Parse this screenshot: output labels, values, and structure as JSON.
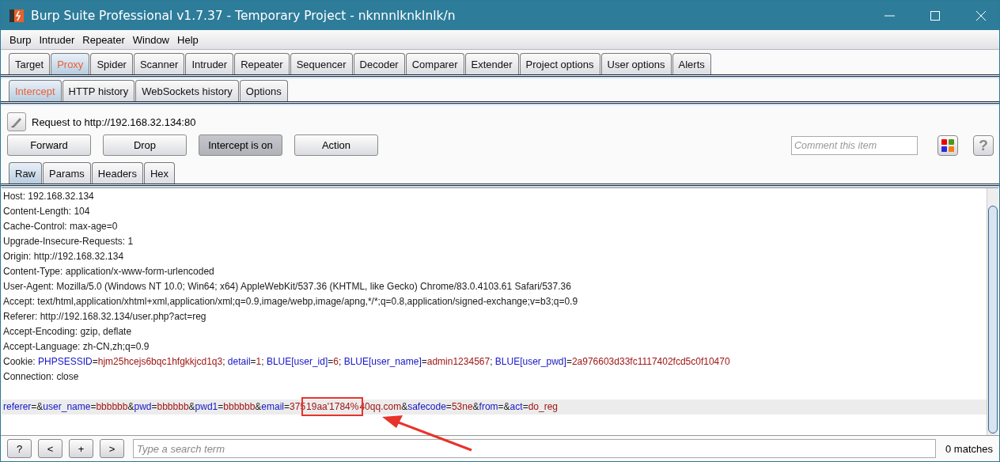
{
  "window": {
    "title": "Burp Suite Professional v1.7.37 - Temporary Project - nknnnlknklnlk/n"
  },
  "menu": [
    "Burp",
    "Intruder",
    "Repeater",
    "Window",
    "Help"
  ],
  "tabs": [
    {
      "label": "Target",
      "selected": false
    },
    {
      "label": "Proxy",
      "selected": true
    },
    {
      "label": "Spider",
      "selected": false
    },
    {
      "label": "Scanner",
      "selected": false
    },
    {
      "label": "Intruder",
      "selected": false
    },
    {
      "label": "Repeater",
      "selected": false
    },
    {
      "label": "Sequencer",
      "selected": false
    },
    {
      "label": "Decoder",
      "selected": false
    },
    {
      "label": "Comparer",
      "selected": false
    },
    {
      "label": "Extender",
      "selected": false
    },
    {
      "label": "Project options",
      "selected": false
    },
    {
      "label": "User options",
      "selected": false
    },
    {
      "label": "Alerts",
      "selected": false
    }
  ],
  "subtabs": [
    {
      "label": "Intercept",
      "selected": true
    },
    {
      "label": "HTTP history",
      "selected": false
    },
    {
      "label": "WebSockets history",
      "selected": false
    },
    {
      "label": "Options",
      "selected": false
    }
  ],
  "request_label": "Request to http://192.168.32.134:80",
  "buttons": [
    {
      "label": "Forward",
      "pressed": false
    },
    {
      "label": "Drop",
      "pressed": false
    },
    {
      "label": "Intercept is on",
      "pressed": true
    },
    {
      "label": "Action",
      "pressed": false
    }
  ],
  "comment": {
    "placeholder": "Comment this item"
  },
  "help_label": "?",
  "editor_tabs": [
    {
      "label": "Raw",
      "selected": true
    },
    {
      "label": "Params",
      "selected": false
    },
    {
      "label": "Headers",
      "selected": false
    },
    {
      "label": "Hex",
      "selected": false
    }
  ],
  "lines": [
    {
      "highlighted": false,
      "segments": [
        {
          "kind": "plain",
          "text": "Host: 192.168.32.134"
        }
      ]
    },
    {
      "highlighted": false,
      "segments": [
        {
          "kind": "plain",
          "text": "Content-Length: 104"
        }
      ]
    },
    {
      "highlighted": false,
      "segments": [
        {
          "kind": "plain",
          "text": "Cache-Control: max-age=0"
        }
      ]
    },
    {
      "highlighted": false,
      "segments": [
        {
          "kind": "plain",
          "text": "Upgrade-Insecure-Requests: 1"
        }
      ]
    },
    {
      "highlighted": false,
      "segments": [
        {
          "kind": "plain",
          "text": "Origin: http://192.168.32.134"
        }
      ]
    },
    {
      "highlighted": false,
      "segments": [
        {
          "kind": "plain",
          "text": "Content-Type: application/x-www-form-urlencoded"
        }
      ]
    },
    {
      "highlighted": false,
      "segments": [
        {
          "kind": "plain",
          "text": "User-Agent: Mozilla/5.0 (Windows NT 10.0; Win64; x64) AppleWebKit/537.36 (KHTML, like Gecko) Chrome/83.0.4103.61 Safari/537.36"
        }
      ]
    },
    {
      "highlighted": false,
      "segments": [
        {
          "kind": "plain",
          "text": "Accept: text/html,application/xhtml+xml,application/xml;q=0.9,image/webp,image/apng,*/*;q=0.8,application/signed-exchange;v=b3;q=0.9"
        }
      ]
    },
    {
      "highlighted": false,
      "segments": [
        {
          "kind": "plain",
          "text": "Referer: http://192.168.32.134/user.php?act=reg"
        }
      ]
    },
    {
      "highlighted": false,
      "segments": [
        {
          "kind": "plain",
          "text": "Accept-Encoding: gzip, deflate"
        }
      ]
    },
    {
      "highlighted": false,
      "segments": [
        {
          "kind": "plain",
          "text": "Accept-Language: zh-CN,zh;q=0.9"
        }
      ]
    },
    {
      "highlighted": false,
      "segments": [
        {
          "kind": "plain",
          "text": "Cookie: "
        },
        {
          "kind": "name",
          "text": "PHPSESSID"
        },
        {
          "kind": "plain",
          "text": "="
        },
        {
          "kind": "value",
          "text": "hjm25hcejs6bqc1hfgkkjcd1q3"
        },
        {
          "kind": "plain",
          "text": "; "
        },
        {
          "kind": "name",
          "text": "detail"
        },
        {
          "kind": "plain",
          "text": "="
        },
        {
          "kind": "value",
          "text": "1"
        },
        {
          "kind": "plain",
          "text": "; "
        },
        {
          "kind": "name",
          "text": "BLUE[user_id]"
        },
        {
          "kind": "plain",
          "text": "="
        },
        {
          "kind": "value",
          "text": "6"
        },
        {
          "kind": "plain",
          "text": "; "
        },
        {
          "kind": "name",
          "text": "BLUE[user_name]"
        },
        {
          "kind": "plain",
          "text": "="
        },
        {
          "kind": "value",
          "text": "admin1234567"
        },
        {
          "kind": "plain",
          "text": "; "
        },
        {
          "kind": "name",
          "text": "BLUE[user_pwd]"
        },
        {
          "kind": "plain",
          "text": "="
        },
        {
          "kind": "value",
          "text": "2a976603d33fc1117402fcd5c0f10470"
        }
      ]
    },
    {
      "highlighted": false,
      "segments": [
        {
          "kind": "plain",
          "text": "Connection: close"
        }
      ]
    },
    {
      "highlighted": false
    },
    {
      "highlighted": true,
      "segments": [
        {
          "kind": "name",
          "text": "referer"
        },
        {
          "kind": "plain",
          "text": "=&"
        },
        {
          "kind": "name",
          "text": "user_name"
        },
        {
          "kind": "plain",
          "text": "="
        },
        {
          "kind": "value",
          "text": "bbbbbb"
        },
        {
          "kind": "plain",
          "text": "&"
        },
        {
          "kind": "name",
          "text": "pwd"
        },
        {
          "kind": "plain",
          "text": "="
        },
        {
          "kind": "value",
          "text": "bbbbbb"
        },
        {
          "kind": "plain",
          "text": "&"
        },
        {
          "kind": "name",
          "text": "pwd1"
        },
        {
          "kind": "plain",
          "text": "="
        },
        {
          "kind": "value",
          "text": "bbbbbb"
        },
        {
          "kind": "plain",
          "text": "&"
        },
        {
          "kind": "name",
          "text": "email"
        },
        {
          "kind": "plain",
          "text": "="
        },
        {
          "kind": "value",
          "text": "375"
        },
        {
          "kind": "value",
          "text": "19aa'1784%",
          "annotated": true
        },
        {
          "kind": "value",
          "text": "40qq.com"
        },
        {
          "kind": "plain",
          "text": "&"
        },
        {
          "kind": "name",
          "text": "safecode"
        },
        {
          "kind": "plain",
          "text": "="
        },
        {
          "kind": "value",
          "text": "53ne"
        },
        {
          "kind": "plain",
          "text": "&"
        },
        {
          "kind": "name",
          "text": "from"
        },
        {
          "kind": "plain",
          "text": "=&"
        },
        {
          "kind": "name",
          "text": "act"
        },
        {
          "kind": "plain",
          "text": "="
        },
        {
          "kind": "value",
          "text": "do_reg"
        }
      ]
    }
  ],
  "search_buttons": [
    "?",
    "<",
    "+",
    ">"
  ],
  "search": {
    "placeholder": "Type a search term"
  },
  "matches": "0 matches"
}
